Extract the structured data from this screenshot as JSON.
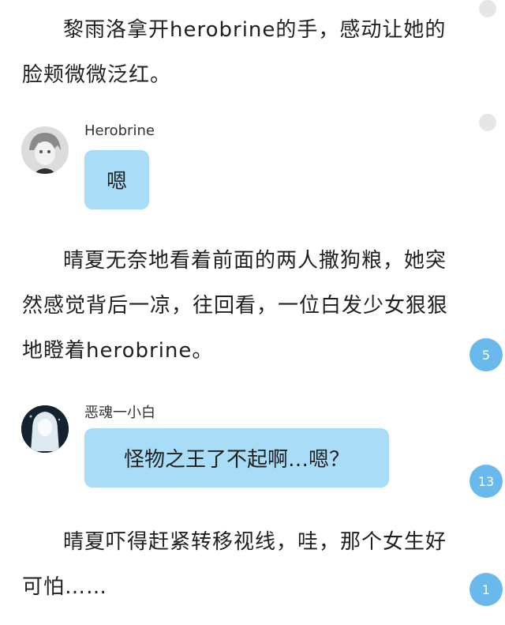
{
  "paragraphs": [
    "黎雨洛拿开herobrine的手，感动让她的脸颊微微泛红。",
    "晴夏无奈地看着前面的两人撒狗粮，她突然感觉背后一凉，往回看，一位白发少女狠狠地瞪着herobrine。",
    "晴夏吓得赶紧转移视线，哇，那个女生好可怕……"
  ],
  "chats": [
    {
      "name": "Herobrine",
      "message": "嗯",
      "avatar_icon": "anime-boy-avatar-icon"
    },
    {
      "name": "恶魂一小白",
      "message": "怪物之王了不起啊…嗯？",
      "avatar_icon": "ghost-girl-avatar-icon"
    }
  ],
  "comment_badges": [
    "5",
    "13",
    "1"
  ],
  "colors": {
    "bubble": "#a9dcf7",
    "badge": "#6ab9ec",
    "dot": "#e6e6e6"
  }
}
